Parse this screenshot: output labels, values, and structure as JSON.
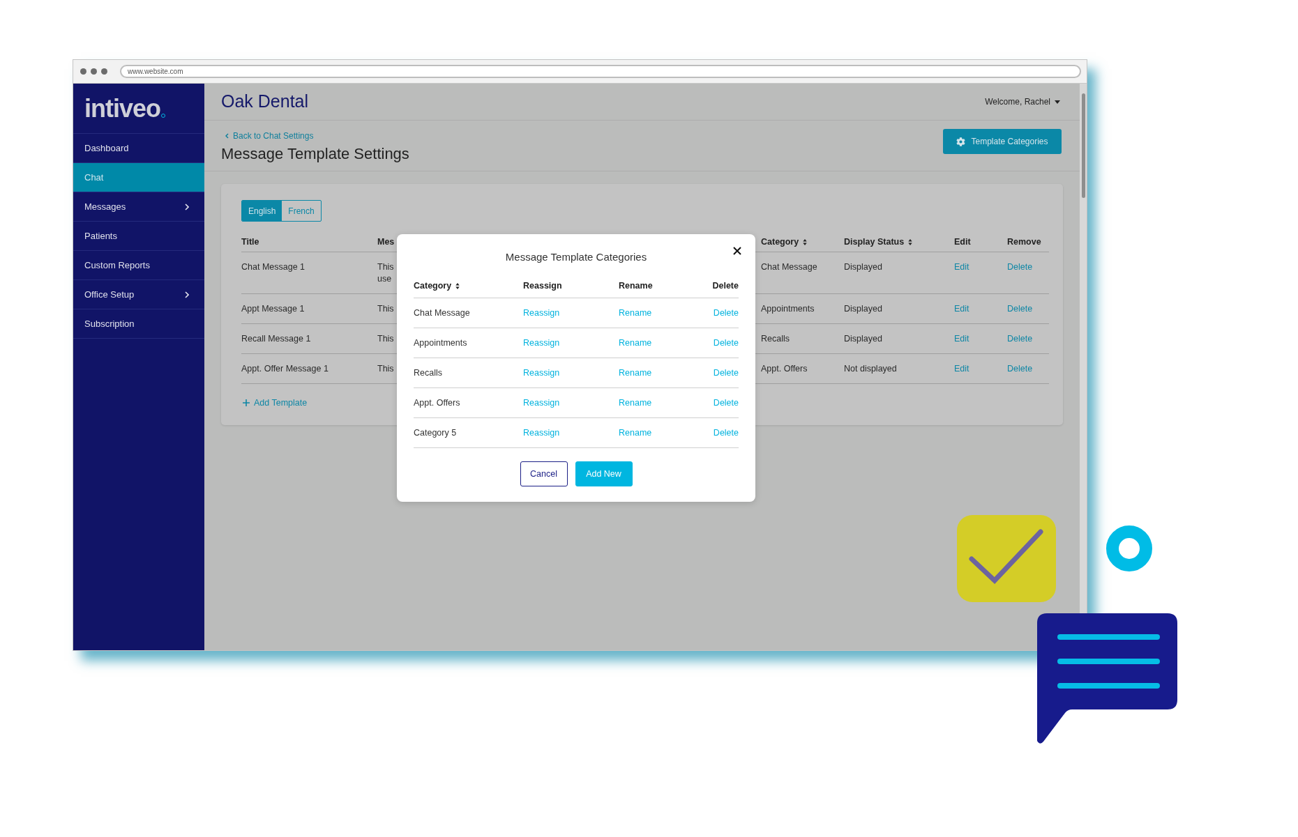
{
  "browser": {
    "url": "www.website.com"
  },
  "sidebar": {
    "logo": "intiveo",
    "items": [
      {
        "label": "Dashboard",
        "selected": false,
        "submenu": false
      },
      {
        "label": "Chat",
        "selected": true,
        "submenu": false
      },
      {
        "label": "Messages",
        "selected": false,
        "submenu": true
      },
      {
        "label": "Patients",
        "selected": false,
        "submenu": false
      },
      {
        "label": "Custom Reports",
        "selected": false,
        "submenu": false
      },
      {
        "label": "Office Setup",
        "selected": false,
        "submenu": true
      },
      {
        "label": "Subscription",
        "selected": false,
        "submenu": false
      }
    ]
  },
  "header": {
    "practice": "Oak Dental",
    "user_menu": "Welcome, Rachel"
  },
  "page": {
    "back_link": "Back to Chat Settings",
    "title": "Message Template Settings",
    "categories_button": "Template Categories"
  },
  "language_tabs": [
    {
      "label": "English",
      "selected": true
    },
    {
      "label": "French",
      "selected": false
    }
  ],
  "templates_table": {
    "columns": [
      {
        "label": "Title",
        "sortable": false
      },
      {
        "label": "Mes",
        "sortable": false
      },
      {
        "label": "Category",
        "sortable": true
      },
      {
        "label": "Display Status",
        "sortable": true
      },
      {
        "label": "Edit",
        "sortable": false
      },
      {
        "label": "Remove",
        "sortable": false
      }
    ],
    "rows": [
      {
        "title": "Chat Message 1",
        "message": "This\nuse",
        "category": "Chat Message",
        "display_status": "Displayed",
        "edit": "Edit",
        "remove": "Delete"
      },
      {
        "title": "Appt Message 1",
        "message": "This",
        "category": "Appointments",
        "display_status": "Displayed",
        "edit": "Edit",
        "remove": "Delete"
      },
      {
        "title": "Recall Message 1",
        "message": "This",
        "category": "Recalls",
        "display_status": "Displayed",
        "edit": "Edit",
        "remove": "Delete"
      },
      {
        "title": "Appt. Offer Message 1",
        "message": "This",
        "category": "Appt. Offers",
        "display_status": "Not displayed",
        "edit": "Edit",
        "remove": "Delete"
      }
    ]
  },
  "add_template": "Add Template",
  "modal": {
    "title": "Message Template Categories",
    "columns": [
      {
        "label": "Category",
        "sortable": true
      },
      {
        "label": "Reassign",
        "sortable": false
      },
      {
        "label": "Rename",
        "sortable": false
      },
      {
        "label": "Delete",
        "sortable": false
      }
    ],
    "rows": [
      {
        "category": "Chat Message",
        "reassign": "Reassign",
        "rename": "Rename",
        "delete": "Delete"
      },
      {
        "category": "Appointments",
        "reassign": "Reassign",
        "rename": "Rename",
        "delete": "Delete"
      },
      {
        "category": "Recalls",
        "reassign": "Reassign",
        "rename": "Rename",
        "delete": "Delete"
      },
      {
        "category": "Appt. Offers",
        "reassign": "Reassign",
        "rename": "Rename",
        "delete": "Delete"
      },
      {
        "category": "Category 5",
        "reassign": "Reassign",
        "rename": "Rename",
        "delete": "Delete"
      }
    ],
    "buttons": [
      {
        "label": "Cancel",
        "kind": "secondary"
      },
      {
        "label": "Add New",
        "kind": "primary"
      }
    ]
  }
}
